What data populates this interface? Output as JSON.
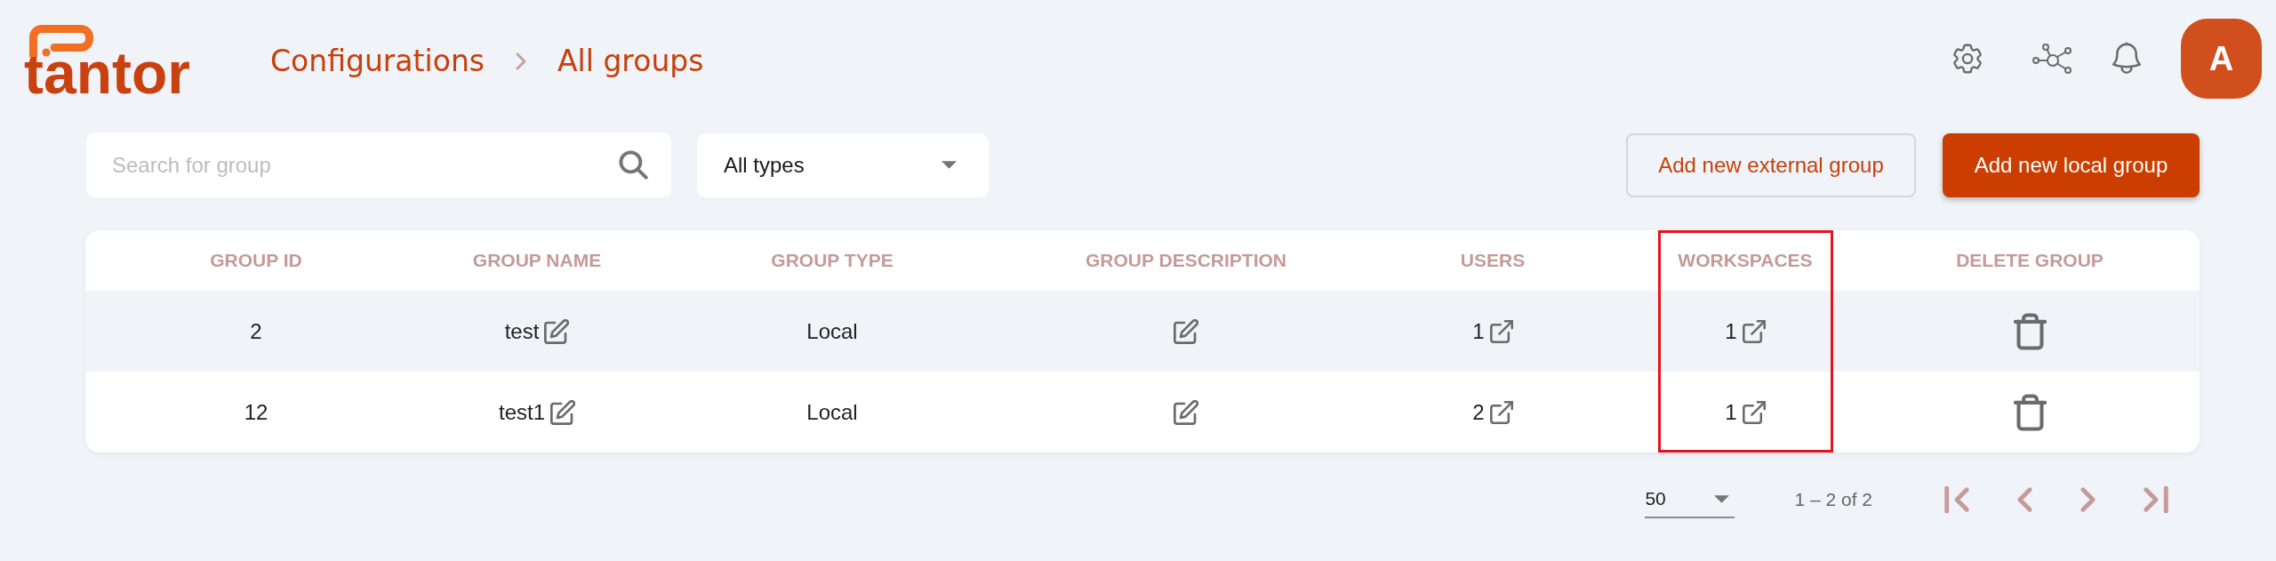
{
  "logo": {
    "text": "tantor"
  },
  "breadcrumb": [
    {
      "label": "Configurations"
    },
    {
      "label": "All groups"
    }
  ],
  "avatar": {
    "initial": "A"
  },
  "toolbar": {
    "search": {
      "placeholder": "Search for group"
    },
    "type_filter": {
      "value": "All types"
    },
    "buttons": [
      {
        "label": "Add new external group",
        "kind": "outlined"
      },
      {
        "label": "Add new local group",
        "kind": "filled"
      }
    ]
  },
  "table": {
    "columns": [
      {
        "label": "GROUP ID",
        "marked": false
      },
      {
        "label": "GROUP NAME",
        "marked": false
      },
      {
        "label": "GROUP TYPE",
        "marked": false
      },
      {
        "label": "GROUP DESCRIPTION",
        "marked": false
      },
      {
        "label": "USERS",
        "marked": false
      },
      {
        "label": "WORKSPACES",
        "marked": true
      },
      {
        "label": "DELETE GROUP",
        "marked": false
      }
    ],
    "rows": [
      {
        "shaded": true,
        "cells": [
          {
            "kind": "text",
            "text": "2"
          },
          {
            "kind": "text_edit",
            "text": "test"
          },
          {
            "kind": "text",
            "text": "Local"
          },
          {
            "kind": "edit"
          },
          {
            "kind": "link",
            "text": "1"
          },
          {
            "kind": "link",
            "text": "1"
          },
          {
            "kind": "delete"
          }
        ]
      },
      {
        "shaded": false,
        "cells": [
          {
            "kind": "text",
            "text": "12"
          },
          {
            "kind": "text_edit",
            "text": "test1"
          },
          {
            "kind": "text",
            "text": "Local"
          },
          {
            "kind": "edit"
          },
          {
            "kind": "link",
            "text": "2"
          },
          {
            "kind": "link",
            "text": "1"
          },
          {
            "kind": "delete"
          }
        ]
      }
    ]
  },
  "pagination": {
    "page_size": "50",
    "range": "1 – 2 of 2"
  }
}
